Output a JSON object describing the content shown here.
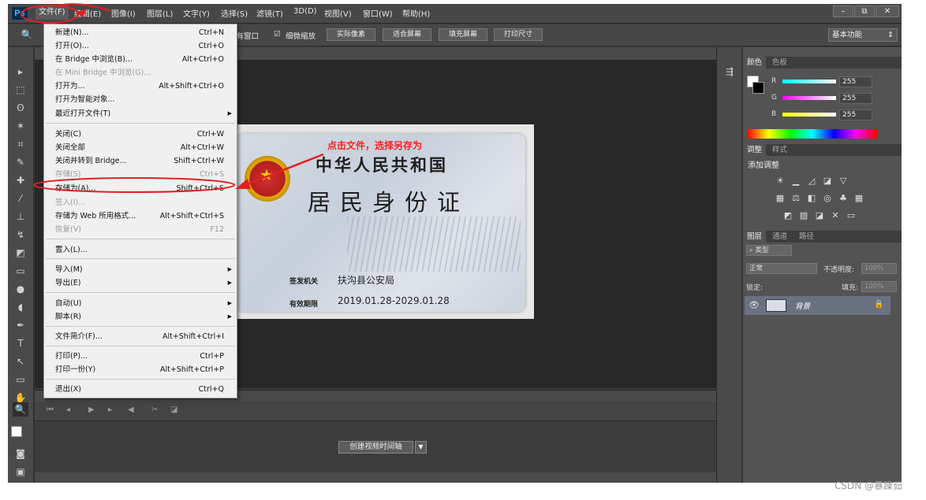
{
  "app": {
    "logo": "Ps",
    "menu": [
      "文件(F)",
      "编辑(E)",
      "图像(I)",
      "图层(L)",
      "文字(Y)",
      "选择(S)",
      "滤镜(T)",
      "3D(D)",
      "视图(V)",
      "窗口(W)",
      "帮助(H)"
    ],
    "window_buttons": [
      "–",
      "⧉",
      "✕"
    ]
  },
  "options_bar": {
    "all_windows_label": "所有窗口",
    "scrubby_zoom_label": "细微缩放",
    "buttons": [
      "实际像素",
      "适合屏幕",
      "填充屏幕",
      "打印尺寸"
    ],
    "workspace": "基本功能"
  },
  "file_menu": {
    "items": [
      {
        "label": "新建(N)...",
        "shortcut": "Ctrl+N",
        "disabled": false
      },
      {
        "label": "打开(O)...",
        "shortcut": "Ctrl+O",
        "disabled": false
      },
      {
        "label": "在 Bridge 中浏览(B)...",
        "shortcut": "Alt+Ctrl+O",
        "disabled": false
      },
      {
        "label": "在 Mini Bridge 中浏览(G)...",
        "shortcut": "",
        "disabled": true
      },
      {
        "label": "打开为...",
        "shortcut": "Alt+Shift+Ctrl+O",
        "disabled": false
      },
      {
        "label": "打开为智能对象...",
        "shortcut": "",
        "disabled": false
      },
      {
        "label": "最近打开文件(T)",
        "shortcut": "",
        "disabled": false,
        "submenu": true
      },
      {
        "label": "关闭(C)",
        "shortcut": "Ctrl+W",
        "disabled": false
      },
      {
        "label": "关闭全部",
        "shortcut": "Alt+Ctrl+W",
        "disabled": false
      },
      {
        "label": "关闭并转到 Bridge...",
        "shortcut": "Shift+Ctrl+W",
        "disabled": false
      },
      {
        "label": "存储(S)",
        "shortcut": "Ctrl+S",
        "disabled": true
      },
      {
        "label": "存储为(A)...",
        "shortcut": "Shift+Ctrl+S",
        "disabled": false
      },
      {
        "label": "签入(I)...",
        "shortcut": "",
        "disabled": true
      },
      {
        "label": "存储为 Web 所用格式...",
        "shortcut": "Alt+Shift+Ctrl+S",
        "disabled": false
      },
      {
        "label": "恢复(V)",
        "shortcut": "F12",
        "disabled": true
      },
      {
        "label": "置入(L)...",
        "shortcut": "",
        "disabled": false
      },
      {
        "label": "导入(M)",
        "shortcut": "",
        "disabled": false,
        "submenu": true
      },
      {
        "label": "导出(E)",
        "shortcut": "",
        "disabled": false,
        "submenu": true
      },
      {
        "label": "自动(U)",
        "shortcut": "",
        "disabled": false,
        "submenu": true
      },
      {
        "label": "脚本(R)",
        "shortcut": "",
        "disabled": false,
        "submenu": true
      },
      {
        "label": "文件简介(F)...",
        "shortcut": "Alt+Shift+Ctrl+I",
        "disabled": false
      },
      {
        "label": "打印(P)...",
        "shortcut": "Ctrl+P",
        "disabled": false
      },
      {
        "label": "打印一份(Y)",
        "shortcut": "Alt+Shift+Ctrl+P",
        "disabled": false
      },
      {
        "label": "退出(X)",
        "shortcut": "Ctrl+Q",
        "disabled": false
      }
    ]
  },
  "annotation": {
    "text": "点击文件，选择另存为",
    "color": "#ff2020"
  },
  "id_card": {
    "country": "中华人民共和国",
    "title": "居民身份证",
    "authority_label": "签发机关",
    "authority_value": "扶沟县公安局",
    "validity_label": "有效期限",
    "validity_value": "2019.01.28-2029.01.28"
  },
  "timeline": {
    "create_button": "创建视频时间轴"
  },
  "color_panel": {
    "tabs": [
      "颜色",
      "色板"
    ],
    "channels": [
      {
        "name": "R",
        "value": "255"
      },
      {
        "name": "G",
        "value": "255"
      },
      {
        "name": "B",
        "value": "255"
      }
    ]
  },
  "adjustments_panel": {
    "tabs": [
      "调整",
      "样式"
    ],
    "heading": "添加调整"
  },
  "layers_panel": {
    "tabs": [
      "图层",
      "通道",
      "路径"
    ],
    "filter": "类型",
    "blend_mode": "正常",
    "opacity_label": "不透明度:",
    "opacity_value": "100%",
    "lock_label": "锁定:",
    "fill_label": "填充:",
    "fill_value": "100%",
    "layer_name": "背景"
  },
  "watermark": "CSDN @暴躁茹"
}
